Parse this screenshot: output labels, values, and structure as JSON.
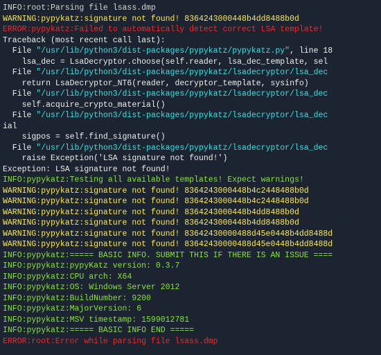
{
  "lines": {
    "l0": "INFO:root:Parsing file lsass.dmp",
    "l1": "WARNING:pypykatz:signature not found! 8364243000448b4dd8488b0d",
    "l2": "ERROR:pypykatz:Failed to automatically detect correct LSA template!",
    "l3": "Traceback (most recent call last):",
    "l4a": "  File ",
    "l4b": "\"/usr/lib/python3/dist-packages/pypykatz/pypykatz.py\"",
    "l4c": ", line 18",
    "l5": "    lsa_dec = LsaDecryptor.choose(self.reader, lsa_dec_template, sel",
    "l6a": "  File ",
    "l6b": "\"/usr/lib/python3/dist-packages/pypykatz/lsadecryptor/lsa_dec",
    "l7": "    return LsaDecryptor_NT6(reader, decryptor_template, sysinfo)",
    "l8a": "  File ",
    "l8b": "\"/usr/lib/python3/dist-packages/pypykatz/lsadecryptor/lsa_dec",
    "l9": "    self.acquire_crypto_material()",
    "l10a": "  File ",
    "l10b": "\"/usr/lib/python3/dist-packages/pypykatz/lsadecryptor/lsa_dec",
    "l11": "ial",
    "l12": "    sigpos = self.find_signature()",
    "l13a": "  File ",
    "l13b": "\"/usr/lib/python3/dist-packages/pypykatz/lsadecryptor/lsa_dec",
    "l14": "    raise Exception('LSA signature not found!')",
    "l15": "Exception: LSA signature not found!",
    "l16": "INFO:pypykatz:Testing all available templates! Expect warnings!",
    "l17": "WARNING:pypykatz:signature not found! 8364243000448b4c2448488b0d",
    "l18": "WARNING:pypykatz:signature not found! 8364243000448b4c2448488b0d",
    "l19": "WARNING:pypykatz:signature not found! 8364243000448b4dd8488b0d",
    "l20": "WARNING:pypykatz:signature not found! 8364243000448b4dd8488b0d",
    "l21": "WARNING:pypykatz:signature not found! 83642430000488d45e0448b4dd8488d",
    "l22": "WARNING:pypykatz:signature not found! 83642430000488d45e0448b4dd8488d",
    "l23": "INFO:pypykatz:===== BASIC INFO. SUBMIT THIS IF THERE IS AN ISSUE ====",
    "l24": "INFO:pypykatz:pypyKatz version: 0.3.7",
    "l25": "INFO:pypykatz:CPU arch: X64",
    "l26": "INFO:pypykatz:OS: Windows Server 2012",
    "l27": "INFO:pypykatz:BuildNumber: 9200",
    "l28": "INFO:pypykatz:MajorVersion: 6",
    "l29": "INFO:pypykatz:MSV timestamp: 1599012781",
    "l30": "INFO:pypykatz:===== BASIC INFO END =====",
    "l31": "ERROR:root:Error while parsing file lsass.dmp"
  }
}
